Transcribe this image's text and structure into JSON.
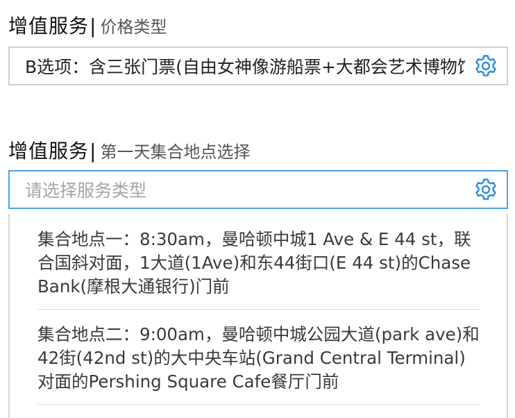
{
  "sections": [
    {
      "title": "增值服务",
      "separator": "|",
      "subtitle": "价格类型",
      "field": {
        "value": "B选项：含三张门票(自由女神像游船票+大都会艺术博物馆+帝国大厦)",
        "icon": "gear-icon"
      }
    },
    {
      "title": "增值服务",
      "separator": "|",
      "subtitle": "第一天集合地点选择",
      "field": {
        "placeholder": "请选择服务类型",
        "icon": "gear-icon"
      },
      "options": [
        "集合地点一：8:30am，曼哈顿中城1 Ave & E 44 st，联合国斜对面，1大道(1Ave)和东44街口(E 44 st)的Chase Bank(摩根大通银行)门前",
        "集合地点二：9:00am，曼哈顿中城公园大道(park ave)和42街(42nd st)的大中央车站(Grand Central Terminal)对面的Pershing Square Cafe餐厅门前"
      ]
    }
  ],
  "colors": {
    "focus_border": "#4aa3e8",
    "icon": "#2b8fe0",
    "border": "#cfcfcf",
    "placeholder": "#a6a6a6"
  }
}
